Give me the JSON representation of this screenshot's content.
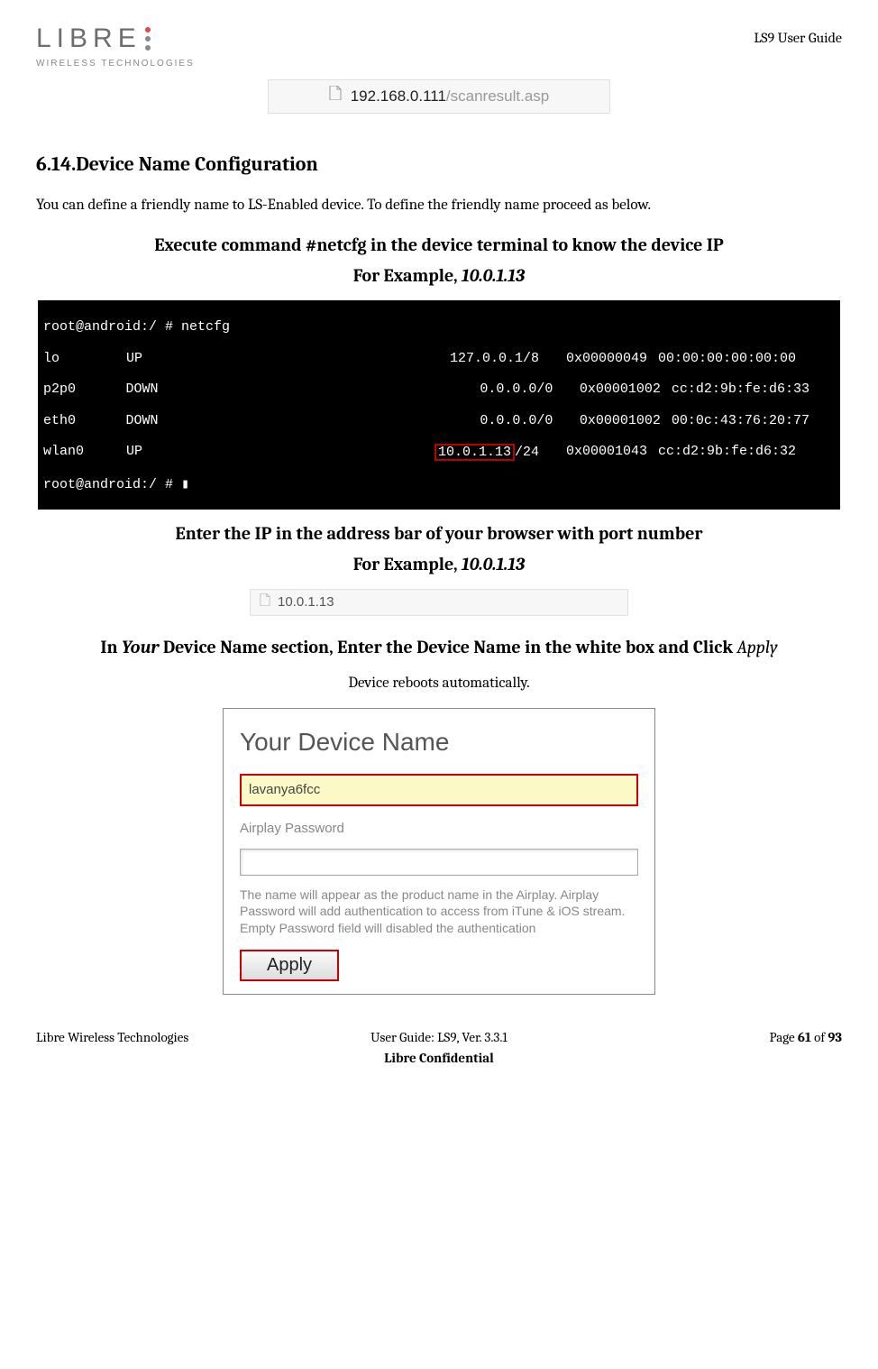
{
  "header": {
    "logo_text": "LIBRE",
    "logo_sub": "WIRELESS TECHNOLOGIES",
    "right": "LS9 User Guide"
  },
  "tab1": {
    "host": "192.168.0.111",
    "path": "/scanresult.asp"
  },
  "section": {
    "number": "6.14.",
    "title": "Device Name Configuration",
    "intro": "You can define a friendly name to LS-Enabled device. To define the friendly name proceed as below."
  },
  "instr1": {
    "line1": "Execute command #netcfg in the device terminal to know the device IP",
    "line2_pre": "For Example, ",
    "line2_ip": "10.0.1.13"
  },
  "terminal": {
    "line0": "root@android:/ #",
    "cmd": "root@android:/ # netcfg",
    "rows": [
      {
        "iface": "lo",
        "state": "UP",
        "ip": "127.0.0.1/8",
        "flags": "0x00000049",
        "mac": "00:00:00:00:00:00"
      },
      {
        "iface": "p2p0",
        "state": "DOWN",
        "ip": "0.0.0.0/0",
        "flags": "0x00001002",
        "mac": "cc:d2:9b:fe:d6:33"
      },
      {
        "iface": "eth0",
        "state": "DOWN",
        "ip": "0.0.0.0/0",
        "flags": "0x00001002",
        "mac": "00:0c:43:76:20:77"
      },
      {
        "iface": "wlan0",
        "state": "UP",
        "ip": "10.0.1.13",
        "suffix": "/24",
        "flags": "0x00001043",
        "mac": "cc:d2:9b:fe:d6:32"
      }
    ],
    "prompt": "root@android:/ # "
  },
  "instr2": {
    "line1": "Enter the IP in the address bar of your browser with port number",
    "line2_pre": "For Example, ",
    "line2_ip": "10.0.1.13"
  },
  "tab2": {
    "text": "10.0.1.13"
  },
  "instr3": {
    "pre": "In ",
    "italic1": "Your",
    "mid": " Device Name section, Enter the Device Name in the white box and Click ",
    "italic2": "Apply"
  },
  "subnote": "Device reboots automatically.",
  "form": {
    "title": "Your Device Name",
    "name_value": "lavanya6fcc",
    "pw_label": "Airplay Password",
    "help": "The name will appear as the product name in the Airplay. Airplay Password will add authentication to access from iTune & iOS stream. Empty Password field will disabled the authentication",
    "apply": "Apply"
  },
  "footer": {
    "left": "Libre Wireless Technologies",
    "center1": "User Guide: LS9, Ver. 3.3.1",
    "center2": "Libre Confidential",
    "right_pre": "Page ",
    "right_cur": "61",
    "right_mid": " of ",
    "right_tot": "93"
  }
}
